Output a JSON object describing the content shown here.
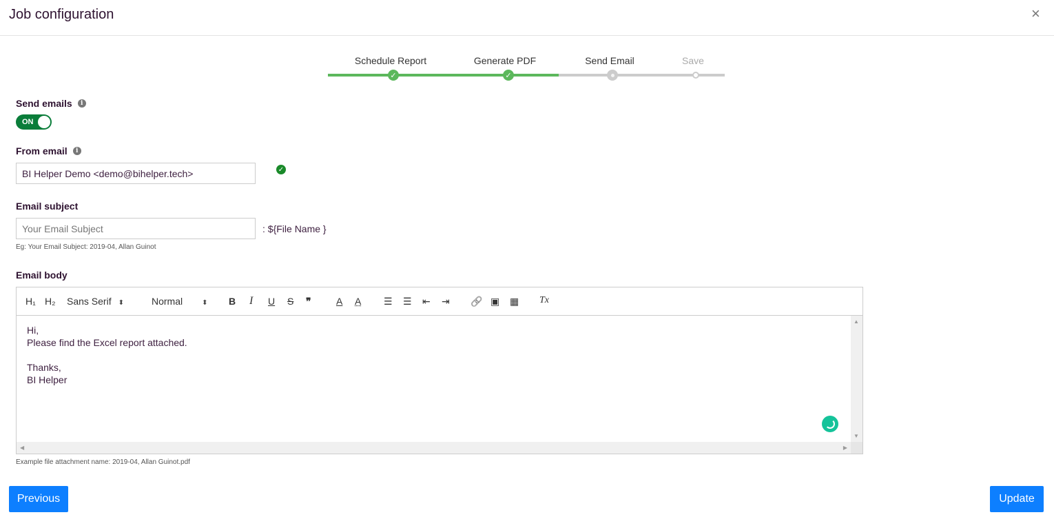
{
  "header": {
    "title": "Job configuration",
    "close": "×"
  },
  "stepper": {
    "steps": [
      {
        "label": "Schedule Report",
        "state": "done"
      },
      {
        "label": "Generate PDF",
        "state": "done"
      },
      {
        "label": "Send Email",
        "state": "current"
      },
      {
        "label": "Save",
        "state": "todo"
      }
    ],
    "colors": {
      "done": "#5cb85c",
      "todo": "#cccccc"
    }
  },
  "send_emails": {
    "label": "Send emails",
    "toggle": "ON",
    "toggle_color": "#0a7d3a"
  },
  "from_email": {
    "label": "From email",
    "value": "BI Helper Demo <demo@bihelper.tech>"
  },
  "email_subject": {
    "label": "Email subject",
    "placeholder": "Your Email Subject",
    "suffix": ": ${File Name }",
    "hint": "Eg: Your Email Subject: 2019-04, Allan Guinot"
  },
  "email_body": {
    "label": "Email body",
    "toolbar": {
      "h1": "H₁",
      "h2": "H₂",
      "font": "Sans Serif",
      "size": "Normal",
      "bold": "B",
      "italic": "I",
      "underline": "U",
      "strike": "S",
      "quote": "❞",
      "color": "A",
      "background": "A",
      "ordered_list": "☰",
      "bullet_list": "☰",
      "outdent": "⇤",
      "indent": "⇥",
      "link": "🔗",
      "image": "▣",
      "video": "▦",
      "clean": "Tx"
    },
    "lines": [
      "Hi,",
      "Please find the Excel report attached.",
      "",
      "Thanks,",
      "BI Helper"
    ],
    "hint": "Example file attachment name: 2019-04, Allan Guinot.pdf"
  },
  "footer": {
    "previous": "Previous",
    "update": "Update"
  }
}
